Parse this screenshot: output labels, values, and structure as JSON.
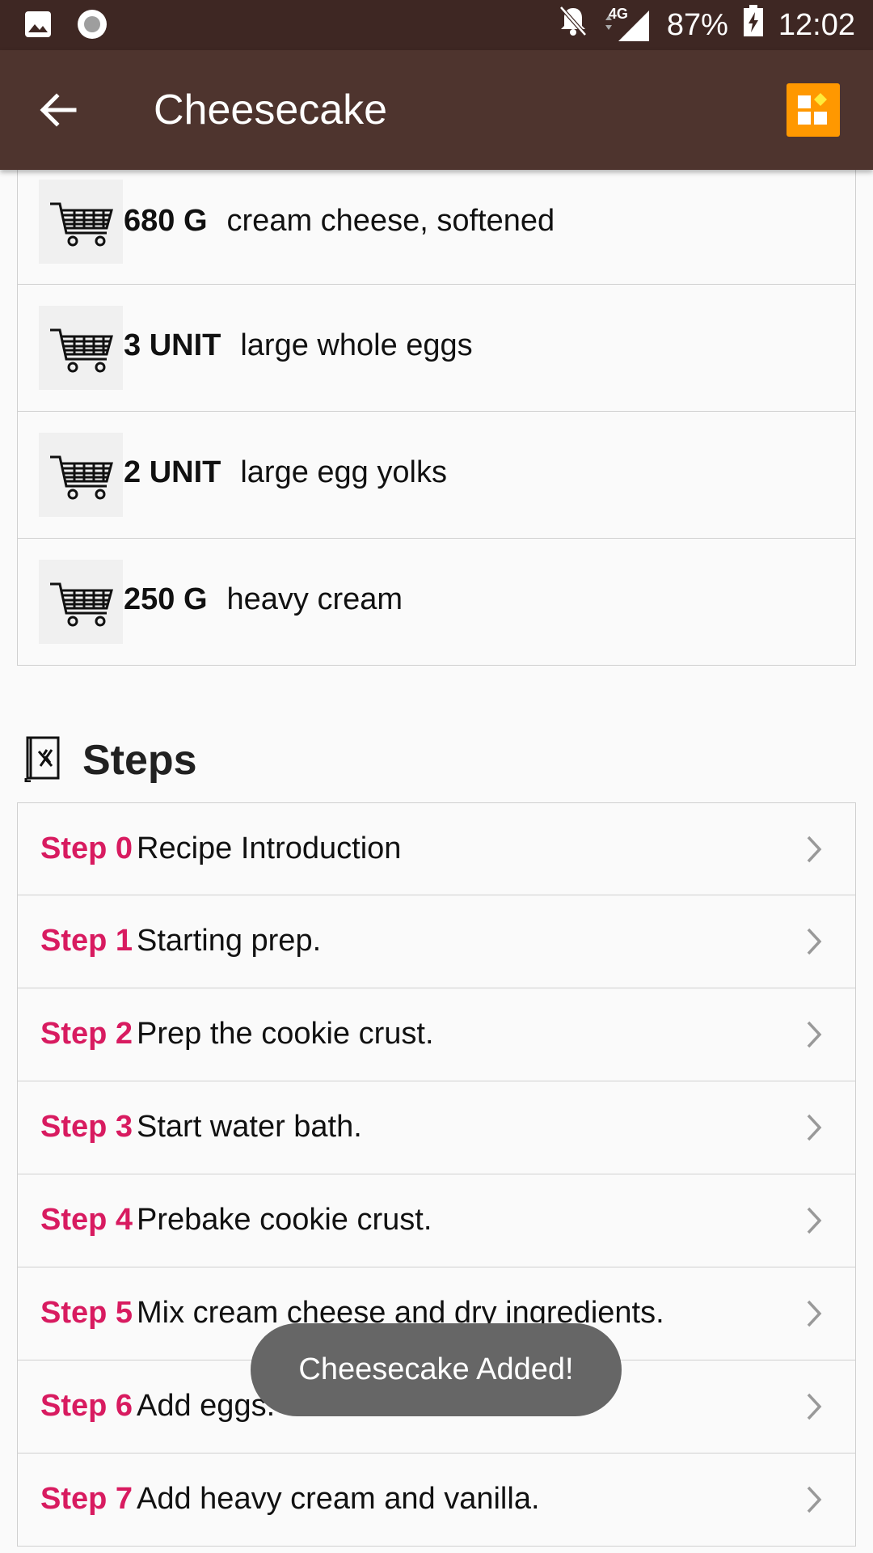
{
  "status_bar": {
    "battery": "87%",
    "time": "12:02",
    "network": "4G",
    "icons": [
      "image-icon",
      "record-icon",
      "bell-off-icon",
      "signal-icon",
      "battery-charging-icon"
    ]
  },
  "app_bar": {
    "title": "Cheesecake",
    "back_icon": "arrow-back-icon",
    "action_icon": "dashboard-icon",
    "accent": "#ff9800",
    "color": "#4e342e"
  },
  "ingredients": [
    {
      "qty": "680 G",
      "name": "cream cheese, softened",
      "icon": "cart-icon"
    },
    {
      "qty": "3 UNIT",
      "name": "large whole eggs",
      "icon": "cart-icon"
    },
    {
      "qty": "2 UNIT",
      "name": "large egg yolks",
      "icon": "cart-icon"
    },
    {
      "qty": "250 G",
      "name": "heavy cream",
      "icon": "cart-icon"
    }
  ],
  "steps_section": {
    "title": "Steps",
    "icon": "recipe-book-icon",
    "label_color": "#d81b60",
    "items": [
      {
        "label": "Step 0",
        "text": "Recipe Introduction"
      },
      {
        "label": "Step 1",
        "text": "Starting prep."
      },
      {
        "label": "Step 2",
        "text": "Prep the cookie crust."
      },
      {
        "label": "Step 3",
        "text": "Start water bath."
      },
      {
        "label": "Step 4",
        "text": "Prebake cookie crust."
      },
      {
        "label": "Step 5",
        "text": "Mix cream cheese and dry ingredients."
      },
      {
        "label": "Step 6",
        "text": "Add eggs."
      },
      {
        "label": "Step 7",
        "text": "Add heavy cream and vanilla."
      }
    ]
  },
  "toast": {
    "message": "Cheesecake Added!"
  }
}
